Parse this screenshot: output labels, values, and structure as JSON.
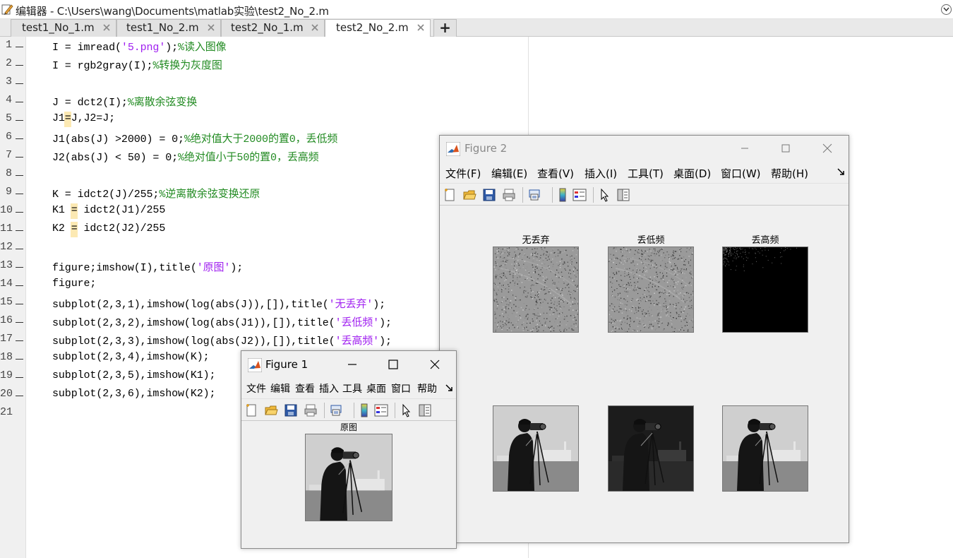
{
  "window_title": "编辑器 - C:\\Users\\wang\\Documents\\matlab实验\\test2_No_2.m",
  "tabs": [
    {
      "label": "test1_No_1.m",
      "active": false
    },
    {
      "label": "test1_No_2.m",
      "active": false
    },
    {
      "label": "test2_No_1.m",
      "active": false
    },
    {
      "label": "test2_No_2.m",
      "active": true
    }
  ],
  "tab_add_label": "+",
  "code_lines": [
    {
      "n": "1",
      "code": "I = imread(",
      "str": "'5.png'",
      "rest": ");",
      "comment": "%读入图像"
    },
    {
      "n": "2",
      "code": "I = rgb2gray(I);",
      "comment": "%转换为灰度图"
    },
    {
      "n": "3",
      "code": ""
    },
    {
      "n": "4",
      "code": "J = dct2(I);",
      "comment": "%离散余弦变换"
    },
    {
      "n": "5",
      "code": "J1=J,J2=J;"
    },
    {
      "n": "6",
      "code": "J1(abs(J) >2000) = 0;",
      "comment": "%绝对值大于2000的置0，丢低频"
    },
    {
      "n": "7",
      "code": "J2(abs(J) < 50) = 0;",
      "comment": "%绝对值小于50的置0，丢高频"
    },
    {
      "n": "8",
      "code": ""
    },
    {
      "n": "9",
      "code": "K = idct2(J)/255;",
      "comment": "%逆离散余弦变换还原"
    },
    {
      "n": "10",
      "code": "K1 = idct2(J1)/255"
    },
    {
      "n": "11",
      "code": "K2 = idct2(J2)/255"
    },
    {
      "n": "12",
      "code": ""
    },
    {
      "n": "13",
      "code": "figure;imshow(I),title(",
      "str": "'原图'",
      "rest": ");"
    },
    {
      "n": "14",
      "code": "figure;"
    },
    {
      "n": "15",
      "code": "subplot(2,3,1),imshow(log(abs(J)),[]),title(",
      "str": "'无丢弃'",
      "rest": ");"
    },
    {
      "n": "16",
      "code": "subplot(2,3,2),imshow(log(abs(J1)),[]),title(",
      "str": "'丢低频'",
      "rest": ");"
    },
    {
      "n": "17",
      "code": "subplot(2,3,3),imshow(log(abs(J2)),[]),title(",
      "str": "'丢高频'",
      "rest": ");"
    },
    {
      "n": "18",
      "code": "subplot(2,3,4),imshow(K);"
    },
    {
      "n": "19",
      "code": "subplot(2,3,5),imshow(K1);"
    },
    {
      "n": "20",
      "code": "subplot(2,3,6),imshow(K2);"
    },
    {
      "n": "21",
      "code": ""
    }
  ],
  "figure2": {
    "title": "Figure 2",
    "menu": [
      "文件(F)",
      "编辑(E)",
      "查看(V)",
      "插入(I)",
      "工具(T)",
      "桌面(D)",
      "窗口(W)",
      "帮助(H)"
    ],
    "captions": [
      "无丢弃",
      "丢低频",
      "丢高频"
    ]
  },
  "figure1": {
    "title": "Figure 1",
    "menu": [
      "文件",
      "编辑",
      "查看",
      "插入",
      "工具",
      "桌面",
      "窗口",
      "帮助"
    ],
    "caption": "原图"
  },
  "colors": {
    "comment": "#228b22",
    "string": "#a020f0",
    "highlight": "#fbe5a6",
    "window_bg": "#f0f0f0"
  },
  "icons": [
    "new-file-icon",
    "open-folder-icon",
    "save-icon",
    "print-icon",
    "link-plot-icon",
    "colorbar-icon",
    "legend-icon",
    "pointer-icon",
    "property-editor-icon"
  ]
}
